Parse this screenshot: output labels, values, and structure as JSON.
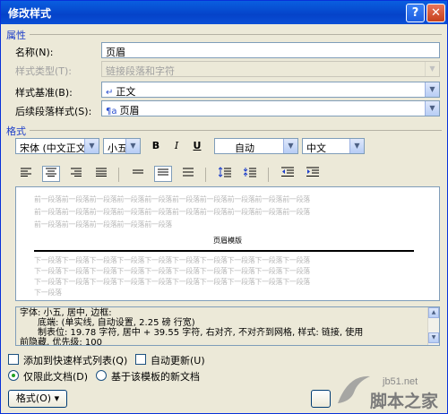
{
  "window": {
    "title": "修改样式",
    "help": "?",
    "close": "✕"
  },
  "properties": {
    "header": "属性",
    "name_label": "名称(N):",
    "name_value": "页眉",
    "style_type_label": "样式类型(T):",
    "style_type_value": "链接段落和字符",
    "based_on_label": "样式基准(B):",
    "based_on_value": "正文",
    "next_style_label": "后续段落样式(S):",
    "next_style_value": "页眉"
  },
  "format": {
    "header": "格式",
    "font": "宋体 (中文正文",
    "size": "小五",
    "bold": "B",
    "italic": "I",
    "underline": "U",
    "color": "自动",
    "language": "中文"
  },
  "preview": {
    "prev_para": "前一段落前一段落前一段落前一段落前一段落前一段落前一段落前一段落前一段落前一段落",
    "prev_para_tail": "前一段落前一段落前一段落前一段落前一段落",
    "sample": "页眉模版",
    "next_para": "下一段落下一段落下一段落下一段落下一段落下一段落下一段落下一段落下一段落下一段落",
    "next_para_tail": "下一段落"
  },
  "description": {
    "line1": "字体: 小五, 居中, 边框:",
    "line2": "底端: (单实线, 自动设置, 2.25 磅 行宽)",
    "line3": "制表位: 19.78 字符, 居中 + 39.55 字符, 右对齐, 不对齐到网格, 样式: 链接, 使用",
    "line4": "前隐藏, 优先级: 100"
  },
  "options": {
    "add_quick": "添加到快速样式列表(Q)",
    "auto_update": "自动更新(U)",
    "only_doc": "仅限此文档(D)",
    "new_docs": "基于该模板的新文档"
  },
  "buttons": {
    "format": "格式(O) ▾"
  },
  "watermark": {
    "line1": "jb51.net",
    "line2": "脚本之家"
  }
}
